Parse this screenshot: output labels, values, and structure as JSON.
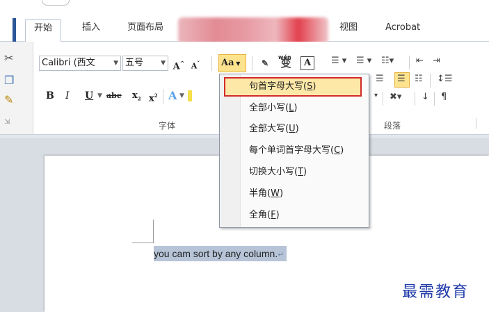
{
  "tabs": [
    {
      "label": "开始",
      "active": true
    },
    {
      "label": "插入"
    },
    {
      "label": "页面布局"
    },
    {
      "label": "视图"
    },
    {
      "label": "Acrobat"
    }
  ],
  "font": {
    "name": "Calibri (西文",
    "size": "五号",
    "grow_icon": "A",
    "shrink_icon": "A",
    "change_case_label": "Aa",
    "phonetic_label": "wén"
  },
  "format_row": {
    "bold": "B",
    "italic": "I",
    "underline": "U",
    "strike": "abe",
    "subscript": "x",
    "superscript": "x"
  },
  "groups": {
    "font": "字体",
    "paragraph": "段落"
  },
  "change_case_menu": [
    {
      "label": "句首字母大写",
      "key": "S",
      "highlighted": true
    },
    {
      "label": "全部小写",
      "key": "L"
    },
    {
      "label": "全部大写",
      "key": "U"
    },
    {
      "label": "每个单词首字母大写",
      "key": "C"
    },
    {
      "label": "切换大小写",
      "key": "T"
    },
    {
      "label": "半角",
      "key": "W"
    },
    {
      "label": "全角",
      "key": "F"
    }
  ],
  "document": {
    "selected_text": "you cam sort by any column.",
    "paragraph_mark": "↵"
  },
  "watermark": "最需教育",
  "colors": {
    "accent": "#2b5797",
    "highlight": "#fde38e",
    "menu_border": "#d22a2a",
    "selection": "#b7c4d8"
  }
}
